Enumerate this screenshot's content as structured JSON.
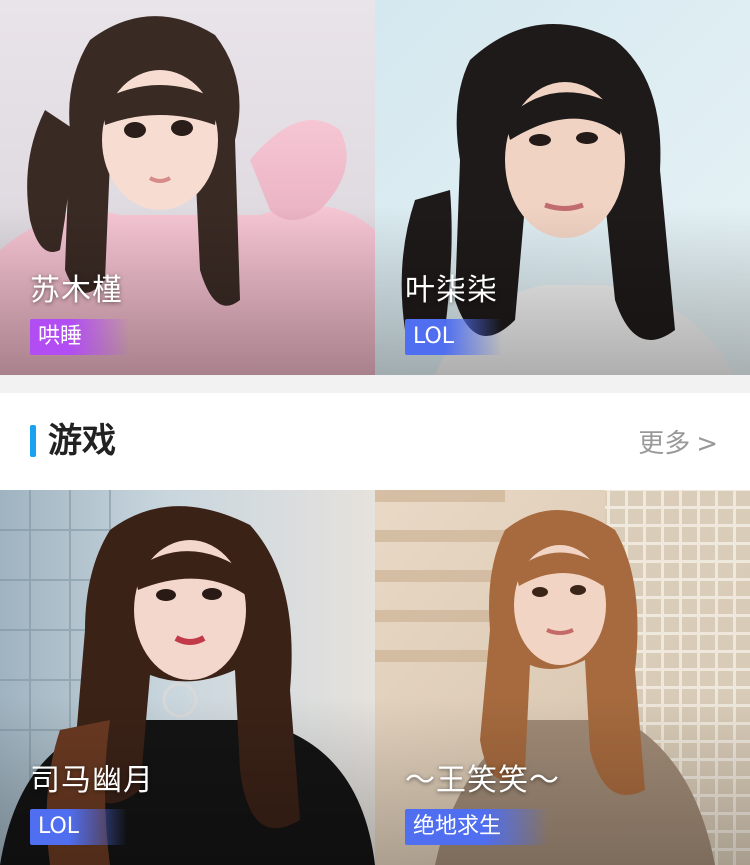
{
  "colors": {
    "section_accent": "#1aa1f0",
    "tag_purple": "#b14df2",
    "tag_blue": "#4f6ef0",
    "divider": "#f2f2f2"
  },
  "top_cards": [
    {
      "name": "苏木槿",
      "tag": "哄睡",
      "tag_color": "#b14df2"
    },
    {
      "name": "叶柒柒",
      "tag": "LOL",
      "tag_color": "#4f6ef0"
    }
  ],
  "section": {
    "title": "游戏",
    "more_label": "更多",
    "more_icon": "chevron-right-icon"
  },
  "bottom_cards": [
    {
      "name": "司马幽月",
      "tag": "LOL",
      "tag_color": "#4f6ef0"
    },
    {
      "name": "～王笑笑～",
      "tag": "绝地求生",
      "tag_color": "#4f6ef0"
    }
  ]
}
